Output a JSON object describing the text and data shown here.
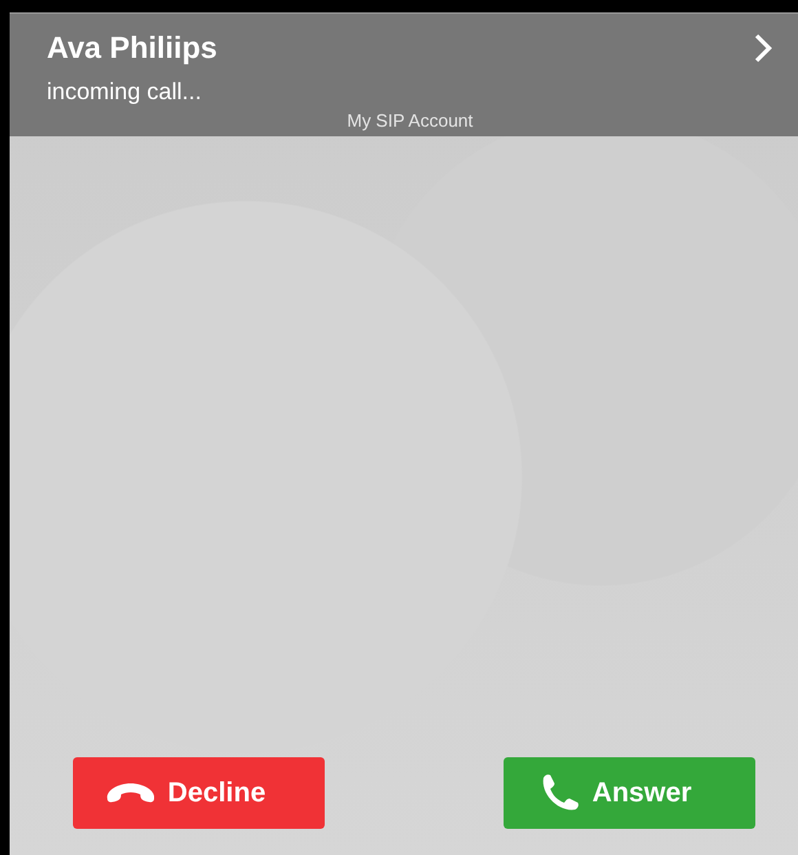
{
  "caller": {
    "name": "Ava Philiips",
    "status": "incoming call...",
    "account": "My SIP Account"
  },
  "buttons": [
    {
      "kind": "decline",
      "label": "Decline"
    },
    {
      "kind": "answer",
      "label": "Answer"
    }
  ]
}
